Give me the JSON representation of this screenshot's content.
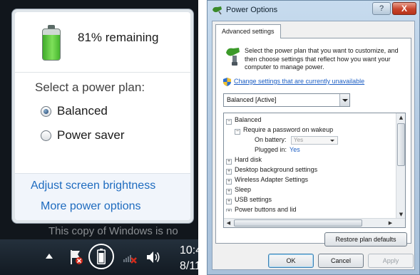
{
  "flyout": {
    "battery_level": 0.81,
    "status": "81% remaining",
    "plan_heading": "Select a power plan:",
    "plans": [
      {
        "label": "Balanced",
        "selected": true
      },
      {
        "label": "Power saver",
        "selected": false
      }
    ],
    "links": {
      "brightness": "Adjust screen brightness",
      "more": "More power options"
    }
  },
  "watermark": "This copy of Windows is no",
  "taskbar": {
    "clock_time": "10:4",
    "clock_date": "8/11",
    "icons": [
      "show-hidden-arrow-icon",
      "action-center-flag-icon",
      "battery-icon",
      "network-disconnected-icon",
      "volume-icon"
    ]
  },
  "dialog": {
    "title": "Power Options",
    "help": "?",
    "close": "X",
    "tab": "Advanced settings",
    "intro": "Select the power plan that you want to customize, and then choose settings that reflect how you want your computer to manage power.",
    "change_link": "Change settings that are currently unavailable",
    "plan_select": "Balanced [Active]",
    "tree": {
      "balanced": "Balanced",
      "require_password": "Require a password on wakeup",
      "on_battery_label": "On battery:",
      "on_battery_value": "Yes",
      "plugged_in_label": "Plugged in:",
      "plugged_in_value": "Yes",
      "hard_disk": "Hard disk",
      "desktop_bg": "Desktop background settings",
      "wireless": "Wireless Adapter Settings",
      "sleep": "Sleep",
      "usb": "USB settings",
      "power_buttons": "Power buttons and lid"
    },
    "restore_button": "Restore plan defaults",
    "ok": "OK",
    "cancel": "Cancel",
    "apply": "Apply"
  },
  "colors": {
    "battery_green": "#4fc434",
    "link_blue": "#1e6bbf",
    "taskbar": "#18212b",
    "close_red": "#c8452c"
  }
}
